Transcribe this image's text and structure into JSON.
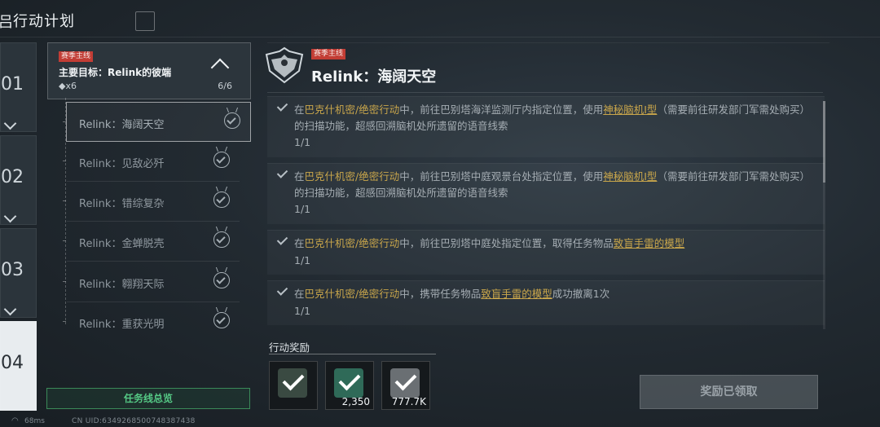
{
  "header": {
    "glyph": "吕",
    "title": "行动计划"
  },
  "season_tabs": [
    {
      "num": "01"
    },
    {
      "num": "02"
    },
    {
      "num": "03"
    },
    {
      "num": "04"
    }
  ],
  "questline": {
    "tag": "赛季主线",
    "title": "主要目标：Relink的彼端",
    "reward": "◆x6",
    "progress": "6/6"
  },
  "sub_quests": [
    "Relink：海阔天空",
    "Relink：见敌必歼",
    "Relink：错综复杂",
    "Relink：金蝉脱壳",
    "Relink：翱翔天际",
    "Relink：重获光明"
  ],
  "summary_button": "任务线总览",
  "status": {
    "ping": "68ms",
    "uid": "CN UID:6349268500748387438"
  },
  "detail": {
    "tag": "赛季主线",
    "title": "Relink：海阔天空"
  },
  "tasks": [
    {
      "p1": "在",
      "y1": "巴克什机密/绝密行动",
      "p2": "中，前往巴别塔海洋监测厅内指定位置，使用",
      "u1": "神秘脑机Ⅰ型",
      "p3": "（需要前往研发部门军需处购买）的扫描功能，超感回溯脑机处所遗留的语音线索",
      "count": "1/1"
    },
    {
      "p1": "在",
      "y1": "巴克什机密/绝密行动",
      "p2": "中，前往巴别塔中庭观景台处指定位置，使用",
      "u1": "神秘脑机Ⅰ型",
      "p3": "（需要前往研发部门军需处购买）的扫描功能，超感回溯脑机处所遗留的语音线索",
      "count": "1/1"
    },
    {
      "p1": "在",
      "y1": "巴克什机密/绝密行动",
      "p2": "中，前往巴别塔中庭处指定位置，取得任务物品",
      "u1": "致盲手雷的模型",
      "p3": "",
      "count": "1/1"
    },
    {
      "p1": "在",
      "y1": "巴克什机密/绝密行动",
      "p2": "中，携带任务物品",
      "u1": "致盲手雷的模型",
      "p3": "成功撤离1次",
      "count": "1/1"
    }
  ],
  "rewards": {
    "label": "行动奖励",
    "items": [
      {
        "amount": "",
        "color": "#3a4a42"
      },
      {
        "amount": "2,350",
        "color": "#2f6a58"
      },
      {
        "amount": "777.7K",
        "color": "#6a6f73"
      }
    ]
  },
  "claim_button": "奖励已领取"
}
